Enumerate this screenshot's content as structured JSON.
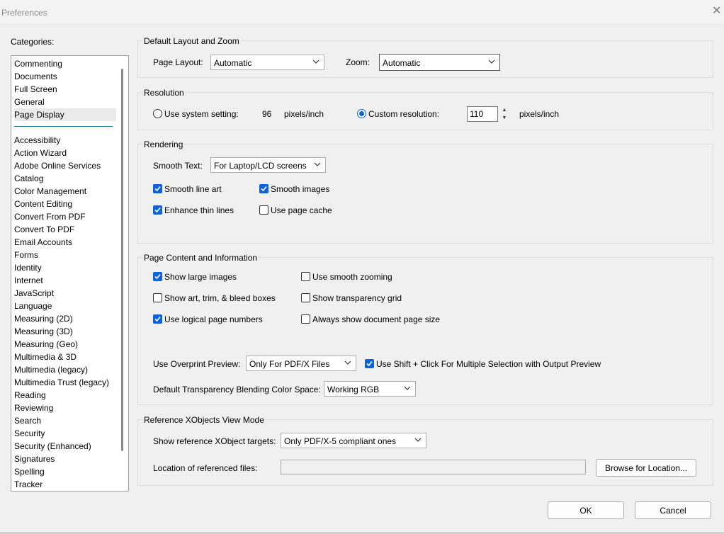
{
  "window": {
    "title": "Preferences",
    "close_glyph": "✕"
  },
  "categories": {
    "label": "Categories:",
    "top_items": [
      "Commenting",
      "Documents",
      "Full Screen",
      "General",
      "Page Display"
    ],
    "items": [
      "Accessibility",
      "Action Wizard",
      "Adobe Online Services",
      "Catalog",
      "Color Management",
      "Content Editing",
      "Convert From PDF",
      "Convert To PDF",
      "Email Accounts",
      "Forms",
      "Identity",
      "Internet",
      "JavaScript",
      "Language",
      "Measuring (2D)",
      "Measuring (3D)",
      "Measuring (Geo)",
      "Multimedia & 3D",
      "Multimedia (legacy)",
      "Multimedia Trust (legacy)",
      "Reading",
      "Reviewing",
      "Search",
      "Security",
      "Security (Enhanced)",
      "Signatures",
      "Spelling",
      "Tracker"
    ],
    "selected": "Page Display"
  },
  "layout_zoom": {
    "title": "Default Layout and Zoom",
    "page_layout_label": "Page Layout:",
    "page_layout_value": "Automatic",
    "zoom_label": "Zoom:",
    "zoom_value": "Automatic"
  },
  "resolution": {
    "title": "Resolution",
    "system_label": "Use system setting:",
    "system_value": "96",
    "unit1": "pixels/inch",
    "custom_label": "Custom resolution:",
    "custom_value": "110",
    "unit2": "pixels/inch",
    "selected": "custom"
  },
  "rendering": {
    "title": "Rendering",
    "smooth_text_label": "Smooth Text:",
    "smooth_text_value": "For Laptop/LCD screens",
    "smooth_line_art": "Smooth line art",
    "smooth_images": "Smooth images",
    "enhance_thin_lines": "Enhance thin lines",
    "use_page_cache": "Use page cache",
    "checked": {
      "smooth_line_art": true,
      "smooth_images": true,
      "enhance_thin_lines": true,
      "use_page_cache": false
    }
  },
  "page_content": {
    "title": "Page Content and Information",
    "show_large_images": "Show large images",
    "use_smooth_zooming": "Use smooth zooming",
    "show_art_trim": "Show art, trim, & bleed boxes",
    "show_transparency_grid": "Show transparency grid",
    "use_logical_page_numbers": "Use logical page numbers",
    "always_show_doc_page_size": "Always show document page size",
    "overprint_label": "Use Overprint Preview:",
    "overprint_value": "Only For PDF/X Files",
    "shift_click_label": "Use Shift + Click For Multiple Selection with Output Preview",
    "blending_label": "Default Transparency Blending Color Space:",
    "blending_value": "Working RGB",
    "checked": {
      "show_large_images": true,
      "use_smooth_zooming": false,
      "show_art_trim": false,
      "show_transparency_grid": false,
      "use_logical_page_numbers": true,
      "always_show_doc_page_size": false,
      "shift_click": true
    }
  },
  "xobjects": {
    "title": "Reference XObjects View Mode",
    "targets_label": "Show reference XObject targets:",
    "targets_value": "Only PDF/X-5 compliant ones",
    "location_label": "Location of referenced files:",
    "location_value": "",
    "browse_label": "Browse for Location..."
  },
  "buttons": {
    "ok": "OK",
    "cancel": "Cancel"
  },
  "colors": {
    "accent": "#0a64d8",
    "separator": "#1e7a8c"
  }
}
